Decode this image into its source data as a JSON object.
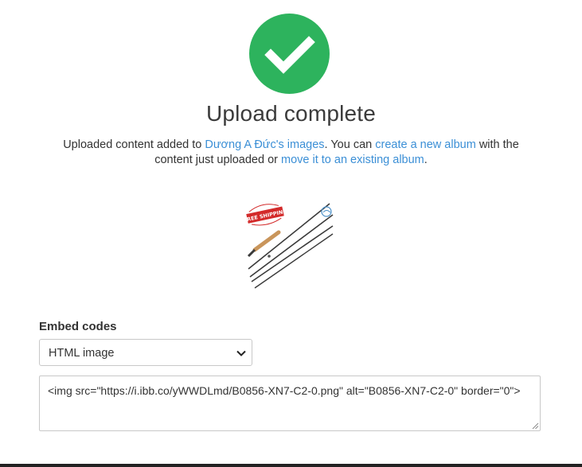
{
  "status": {
    "title": "Upload complete",
    "message_prefix": "Uploaded content added to ",
    "owner_link": "Dương A Đức's images",
    "message_middle": ". You can ",
    "new_album_link": "create a new album",
    "message_middle2": " with the content just uploaded or ",
    "existing_album_link": "move it to an existing album",
    "message_suffix": ".",
    "success_color": "#2db35d",
    "link_color": "#3b8fd6"
  },
  "thumbnail": {
    "badge_text": "FREE SHIPPING",
    "icon": "fishing-rod-product-image"
  },
  "embed": {
    "label": "Embed codes",
    "selected_format": "HTML image",
    "code": "<img src=\"https://i.ibb.co/yWWDLmd/B0856-XN7-C2-0.png\" alt=\"B0856-XN7-C2-0\" border=\"0\">"
  }
}
